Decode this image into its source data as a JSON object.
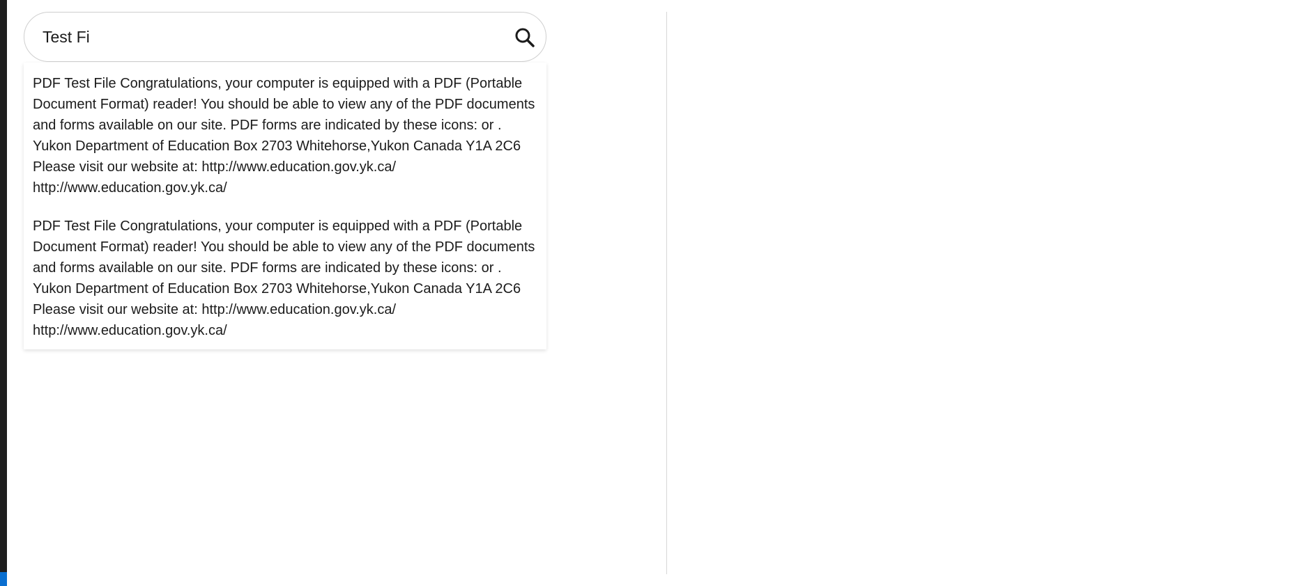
{
  "search": {
    "value": "Test Fi",
    "icon": "search-icon"
  },
  "results": [
    {
      "text": "PDF Test File Congratulations, your computer is equipped with a PDF (Portable Document Format) reader! You should be able to view any of the PDF documents and forms available on our site. PDF forms are indicated by these icons: or . Yukon Department of Education Box 2703 Whitehorse,Yukon Canada Y1A 2C6 Please visit our website at: http://www.education.gov.yk.ca/ http://www.education.gov.yk.ca/"
    },
    {
      "text": "PDF Test File Congratulations, your computer is equipped with a PDF (Portable Document Format) reader! You should be able to view any of the PDF documents and forms available on our site. PDF forms are indicated by these icons: or . Yukon Department of Education Box 2703 Whitehorse,Yukon Canada Y1A 2C6 Please visit our website at: http://www.education.gov.yk.ca/ http://www.education.gov.yk.ca/"
    }
  ],
  "colors": {
    "accent": "#0a6fd0",
    "text": "#1b1b1b",
    "border": "#cfcfcf"
  }
}
